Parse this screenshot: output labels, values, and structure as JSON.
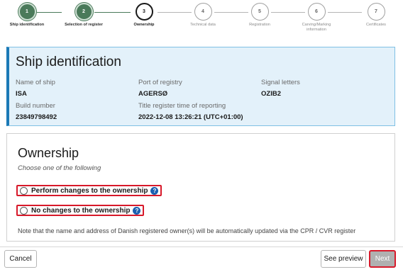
{
  "stepper": {
    "steps": [
      {
        "number": "1",
        "label": "Ship identification",
        "state": "done"
      },
      {
        "number": "2",
        "label": "Selection of register",
        "state": "done"
      },
      {
        "number": "3",
        "label": "Ownership",
        "state": "active"
      },
      {
        "number": "4",
        "label": "Technical data",
        "state": "todo"
      },
      {
        "number": "5",
        "label": "Registration",
        "state": "todo"
      },
      {
        "number": "6",
        "label": "Carving/Marking information",
        "state": "todo"
      },
      {
        "number": "7",
        "label": "Certificates",
        "state": "todo"
      }
    ]
  },
  "ship": {
    "title": "Ship identification",
    "name_label": "Name of ship",
    "name_value": "ISA",
    "port_label": "Port of registry",
    "port_value": "AGERSØ",
    "signal_label": "Signal letters",
    "signal_value": "OZIB2",
    "build_label": "Build number",
    "build_value": "23849798492",
    "time_label": "Title register time of reporting",
    "time_value": "2022-12-08 13:26:21 (UTC+01:00)"
  },
  "ownership": {
    "title": "Ownership",
    "subtitle": "Choose one of the following",
    "option1": "Perform changes to the ownership",
    "option2": "No changes to the ownership",
    "help_glyph": "?",
    "note": "Note that the name and address of Danish registered owner(s) will be automatically updated via the CPR / CVR register"
  },
  "footer": {
    "cancel": "Cancel",
    "preview": "See preview",
    "next": "Next"
  },
  "colors": {
    "done": "#4a7a5a",
    "panel_bg": "#e3f1fa",
    "panel_accent": "#1b79b6",
    "highlight": "#d7192a"
  }
}
